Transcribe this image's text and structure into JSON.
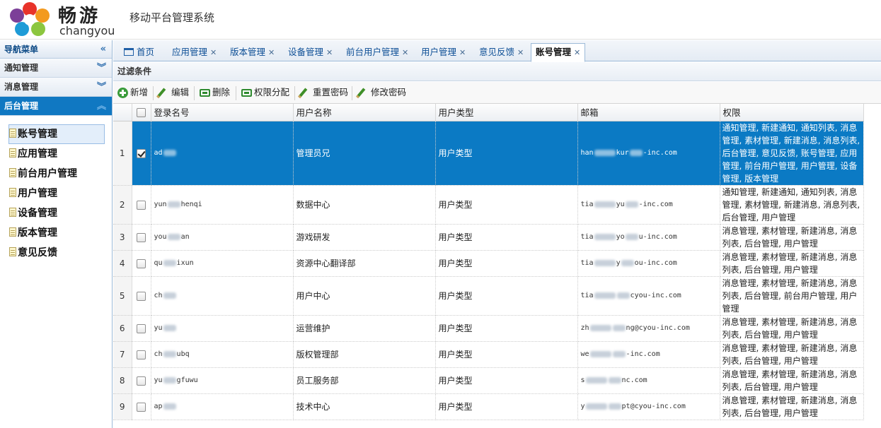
{
  "header": {
    "brand_cn": "畅游",
    "brand_en": "changyou",
    "system_title": "移动平台管理系统"
  },
  "sidebar": {
    "nav_title": "导航菜单",
    "groups": [
      {
        "label": "通知管理"
      },
      {
        "label": "消息管理"
      },
      {
        "label": "后台管理"
      }
    ],
    "items": [
      {
        "label": "账号管理"
      },
      {
        "label": "应用管理"
      },
      {
        "label": "前台用户管理"
      },
      {
        "label": "用户管理"
      },
      {
        "label": "设备管理"
      },
      {
        "label": "版本管理"
      },
      {
        "label": "意见反馈"
      }
    ]
  },
  "tabs": [
    {
      "label": "首页"
    },
    {
      "label": "应用管理"
    },
    {
      "label": "版本管理"
    },
    {
      "label": "设备管理"
    },
    {
      "label": "前台用户管理"
    },
    {
      "label": "用户管理"
    },
    {
      "label": "意见反馈"
    },
    {
      "label": "账号管理"
    }
  ],
  "filter_title": "过滤条件",
  "toolbar": {
    "add": "新增",
    "edit": "编辑",
    "delete": "删除",
    "assign_perm": "权限分配",
    "reset_pwd": "重置密码",
    "change_pwd": "修改密码"
  },
  "table": {
    "columns": {
      "login": "登录名号",
      "username": "用户名称",
      "usertype": "用户类型",
      "email": "邮箱",
      "perm": "权限"
    },
    "rows": [
      {
        "num": "1",
        "login_pre": "ad",
        "login_post": "",
        "name": "管理员兄",
        "type": "用户类型",
        "email_pre": "han",
        "email_mid": "kur",
        "email_post": "-inc.com",
        "perm": "通知管理, 新建通知, 通知列表, 消息管理, 素材管理, 新建消息, 消息列表, 后台管理, 意见反馈, 账号管理, 应用管理, 前台用户管理, 用户管理, 设备管理, 版本管理"
      },
      {
        "num": "2",
        "login_pre": "yun",
        "login_post": "henqi",
        "name": "数据中心",
        "type": "用户类型",
        "email_pre": "tia",
        "email_mid": "yu",
        "email_post": "-inc.com",
        "perm": "通知管理, 新建通知, 通知列表, 消息管理, 素材管理, 新建消息, 消息列表, 后台管理, 用户管理"
      },
      {
        "num": "3",
        "login_pre": "you",
        "login_post": "an",
        "name": "游戏研发",
        "type": "用户类型",
        "email_pre": "tia",
        "email_mid": "yo",
        "email_post": "u-inc.com",
        "perm": "消息管理, 素材管理, 新建消息, 消息列表, 后台管理, 用户管理"
      },
      {
        "num": "4",
        "login_pre": "qu",
        "login_post": "ixun",
        "name": "资源中心翻译部",
        "type": "用户类型",
        "email_pre": "tia",
        "email_mid": "y",
        "email_post": "ou-inc.com",
        "perm": "消息管理, 素材管理, 新建消息, 消息列表, 后台管理, 用户管理"
      },
      {
        "num": "5",
        "login_pre": "ch",
        "login_post": "",
        "name": "用户中心",
        "type": "用户类型",
        "email_pre": "tia",
        "email_mid": "",
        "email_post": "cyou-inc.com",
        "perm": "消息管理, 素材管理, 新建消息, 消息列表, 后台管理, 前台用户管理, 用户管理"
      },
      {
        "num": "6",
        "login_pre": "yu",
        "login_post": "",
        "name": "运营维护",
        "type": "用户类型",
        "email_pre": "zh",
        "email_mid": "",
        "email_post": "ng@cyou-inc.com",
        "perm": "消息管理, 素材管理, 新建消息, 消息列表, 后台管理, 用户管理"
      },
      {
        "num": "7",
        "login_pre": "ch",
        "login_post": "ubq",
        "name": "版权管理部",
        "type": "用户类型",
        "email_pre": "we",
        "email_mid": "",
        "email_post": "-inc.com",
        "perm": "消息管理, 素材管理, 新建消息, 消息列表, 后台管理, 用户管理"
      },
      {
        "num": "8",
        "login_pre": "yu",
        "login_post": "gfuwu",
        "name": "员工服务部",
        "type": "用户类型",
        "email_pre": "s",
        "email_mid": "",
        "email_post": "nc.com",
        "perm": "消息管理, 素材管理, 新建消息, 消息列表, 后台管理, 用户管理"
      },
      {
        "num": "9",
        "login_pre": "ap",
        "login_post": "",
        "name": "技术中心",
        "type": "用户类型",
        "email_pre": "y",
        "email_mid": "",
        "email_post": "pt@cyou-inc.com",
        "perm": "消息管理, 素材管理, 新建消息, 消息列表, 后台管理, 用户管理"
      }
    ]
  }
}
